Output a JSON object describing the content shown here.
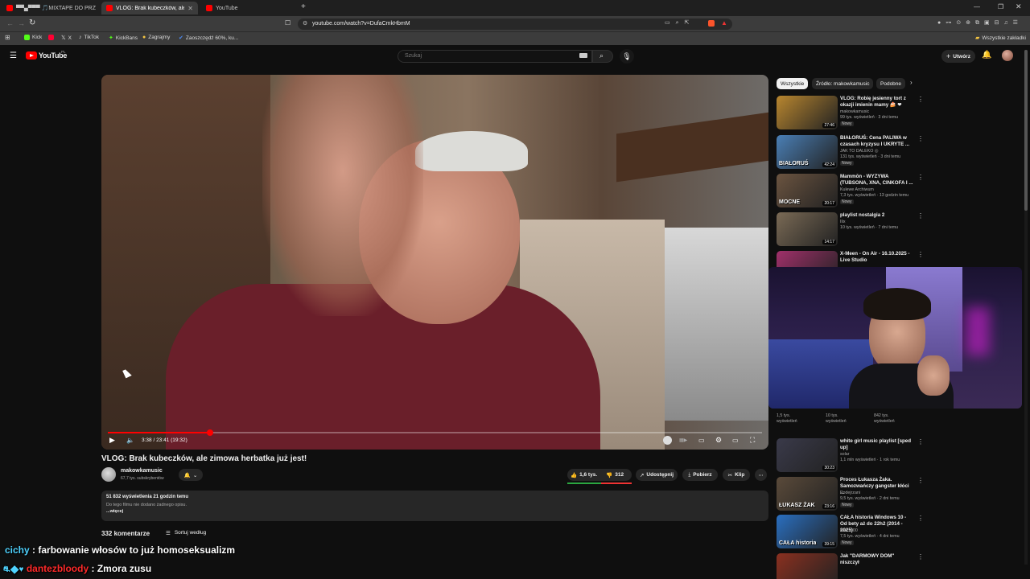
{
  "browser": {
    "tabs": [
      {
        "label": "▀▀▄▀▀▀ 🎵MIXTAPE DO PRZ"
      },
      {
        "label": "VLOG: Brak kubeczków, ale zim"
      },
      {
        "label": "YouTube"
      }
    ],
    "new_tab": "+",
    "url": "youtube.com/watch?v=DufaCmkHbmM",
    "bookmarks": [
      {
        "label": "Kick",
        "color": "#53fc18"
      },
      {
        "label": "",
        "color": "#ff0033"
      },
      {
        "label": "X",
        "color": "#ffffff"
      },
      {
        "label": "TikTok",
        "color": "#ffffff"
      },
      {
        "label": "KickBans",
        "color": "#53fc18"
      },
      {
        "label": "Zagrajmy",
        "color": "#f5c542"
      },
      {
        "label": "Zaoszczędź 60%, ku...",
        "color": "#4c8bf5"
      }
    ],
    "all_bookmarks": "Wszystkie zakładki"
  },
  "youtube": {
    "logo": "YouTube",
    "logo_region": "PL",
    "search_placeholder": "Szukaj",
    "create_label": "Utwórz"
  },
  "player": {
    "time": "3:38 / 23:41 (19:32)",
    "progress": 0.156
  },
  "video": {
    "title": "VLOG: Brak kubeczków, ale zimowa herbatka już jest!",
    "channel": "makowkamusic",
    "subscribers": "67,7 tys. subskrybentów",
    "likes": "1,6 tys.",
    "dislikes": "312",
    "share": "Udostępnij",
    "download": "Pobierz",
    "clip": "Klip",
    "views_date": "51 832 wyświetlenia  21 godzin temu",
    "description": "Do tego filmu nie dodano żadnego opisu.",
    "more": "...więcej",
    "comments_count": "332 komentarze",
    "sort": "Sortuj według"
  },
  "sidebar": {
    "chips": [
      "Wszystkie",
      "Źródło: makowkamusic",
      "Podobne"
    ],
    "items": [
      {
        "title": "VLOG: Robię jesienny tort z okazji imienin mamy 🍰 ❤",
        "channel": "makowkamusic",
        "meta": "99 tys. wyświetleń · 3 dni temu",
        "badge": "Nowy",
        "duration": "27:46",
        "color": "#b8862f"
      },
      {
        "title": "BIAŁORUŚ: Cena PALIWA w czasach kryzysu I UKRYTE ...",
        "channel": "JAK TO DALEKO ◎",
        "meta": "131 tys. wyświetleń · 3 dni temu",
        "badge": "Nowy",
        "duration": "42:24",
        "color": "#4a7fb5",
        "overlay": "BIAŁORUŚ"
      },
      {
        "title": "Mammōn - WYZYWA (TUBSONA, XNA, CINKOFA I ...",
        "channel": "Kulewe Archiwum",
        "meta": "7,3 tys. wyświetleń · 13 godzin temu",
        "badge": "Nowy",
        "duration": "20:17",
        "color": "#6b5440",
        "overlay": "MOCNE"
      },
      {
        "title": "playlist nostalgia 2",
        "channel": "Ilix",
        "meta": "10 tys. wyświetleń · 7 dni temu",
        "badge": "",
        "duration": "14:17",
        "color": "#7a6a55"
      },
      {
        "title": "X-Meen - On Air - 16.10.2025 - Live Studio",
        "channel": "",
        "meta": "",
        "badge": "",
        "duration": "",
        "color": "#a0306a"
      }
    ],
    "partial_views": [
      "1,5 tys. wyświetleń",
      "10 tys. wyświetleń",
      "842 tys. wyświetleń"
    ],
    "items_lower": [
      {
        "title": "white girl music playlist [sped up]",
        "channel": "solar",
        "meta": "1,1 mln wyświetleń · 1 rok temu",
        "badge": "",
        "duration": "30:23",
        "color": "#3a3a4a"
      },
      {
        "title": "Proces Łukasza Żaka. Samozwańczy gangster kłóci ...",
        "channel": "Podejrzani",
        "meta": "9,5 tys. wyświetleń · 2 dni temu",
        "badge": "Nowy",
        "duration": "23:16",
        "color": "#5a4a3a",
        "overlay": "ŁUKASZ ŻAK"
      },
      {
        "title": "CAŁA historia Windows 10 - Od bety aż do 22h2 (2014 - 2025)",
        "channel": "bez 1000",
        "meta": "7,5 tys. wyświetleń · 4 dni temu",
        "badge": "Nowy",
        "duration": "39:15",
        "color": "#2a6fc0",
        "overlay": "CAŁA historia"
      },
      {
        "title": "Jak \"DARMOWY DOM\" niszczył",
        "channel": "",
        "meta": "",
        "badge": "",
        "duration": "",
        "color": "#8a3020"
      }
    ]
  },
  "chat": [
    {
      "user": "cichy",
      "user_color": "#4fd3ff",
      "message": "farbowanie włosów to już homoseksualizm"
    },
    {
      "user": "dantezbloody",
      "user_color": "#ff2a2a",
      "message": "Zmora zusu"
    }
  ]
}
